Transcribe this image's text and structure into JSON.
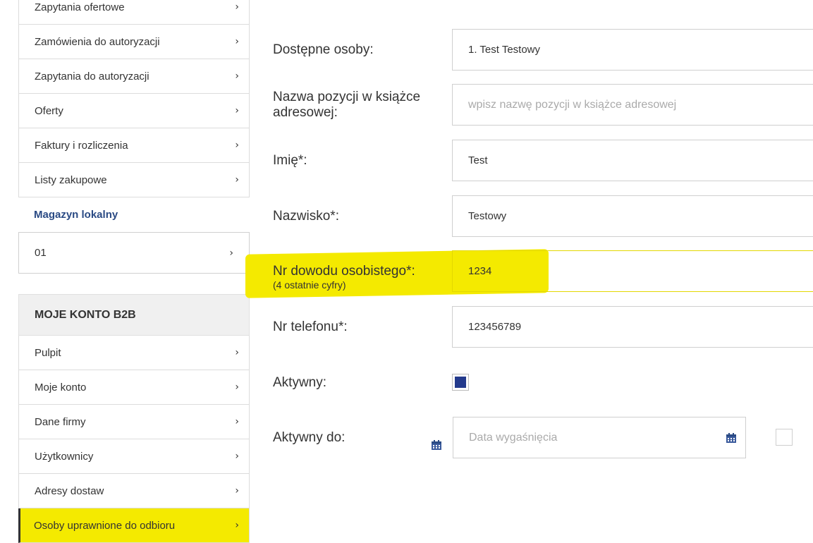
{
  "sidebar": {
    "items_top": [
      {
        "label": "Zapytania ofertowe"
      },
      {
        "label": "Zamówienia do autoryzacji"
      },
      {
        "label": "Zapytania do autoryzacji"
      },
      {
        "label": "Oferty"
      },
      {
        "label": "Faktury i rozliczenia"
      },
      {
        "label": "Listy zakupowe"
      }
    ],
    "warehouse_header": "Magazyn lokalny",
    "warehouse_item": "01",
    "b2b_header": "MOJE KONTO B2B",
    "b2b_items": [
      {
        "label": "Pulpit"
      },
      {
        "label": "Moje konto"
      },
      {
        "label": "Dane firmy"
      },
      {
        "label": "Użytkownicy"
      },
      {
        "label": "Adresy dostaw"
      },
      {
        "label": "Osoby uprawnione do odbioru"
      }
    ],
    "chevron": "›"
  },
  "form": {
    "available_label": "Dostępne osoby:",
    "available_value": "1. Test Testowy",
    "addressbook_label": "Nazwa pozycji w książce adresowej:",
    "addressbook_placeholder": "wpisz nazwę pozycji w książce adresowej",
    "firstname_label": "Imię*:",
    "firstname_value": "Test",
    "lastname_label": "Nazwisko*:",
    "lastname_value": "Testowy",
    "id_label": "Nr dowodu osobistego*:",
    "id_sublabel": "(4 ostatnie cyfry)",
    "id_value": "1234",
    "phone_label": "Nr telefonu*:",
    "phone_value": "123456789",
    "active_label": "Aktywny:",
    "active_checked": true,
    "active_until_label": "Aktywny do:",
    "expiry_placeholder": "Data wygaśnięcia"
  },
  "icons": {
    "calendar": "calendar-icon",
    "chevron": "chevron-right-icon"
  },
  "colors": {
    "accent": "#2a4a84",
    "highlight": "#f4ea00",
    "checkbox": "#233a8c"
  }
}
